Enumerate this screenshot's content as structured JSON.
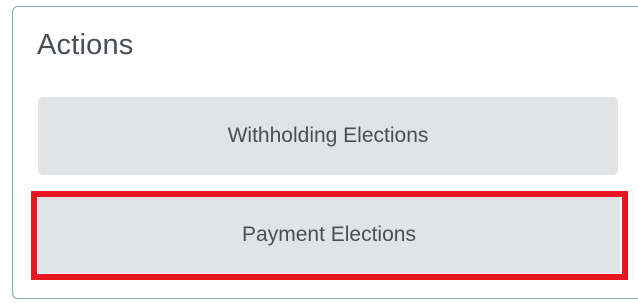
{
  "actions": {
    "title": "Actions",
    "buttons": [
      {
        "label": "Withholding Elections"
      },
      {
        "label": "Payment Elections"
      }
    ]
  },
  "colors": {
    "panel_border": "#7fa7cf",
    "button_bg": "#e0e4e7",
    "text": "#4a4f55",
    "highlight": "#e8171f"
  }
}
